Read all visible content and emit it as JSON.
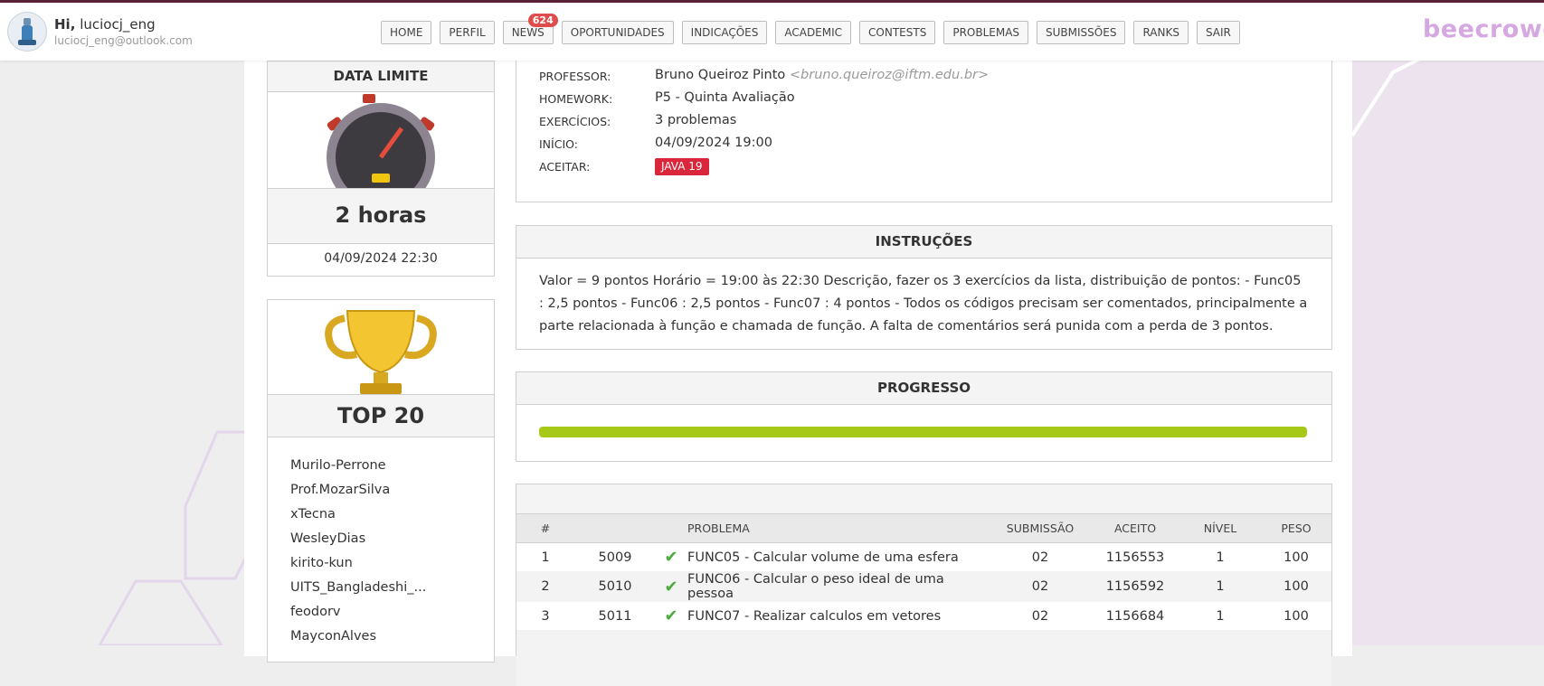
{
  "header": {
    "hi": "Hi,",
    "username": "luciocj_eng",
    "email": "luciocj_eng@outlook.com",
    "brand": "beecrowd",
    "nav": [
      {
        "label": "HOME"
      },
      {
        "label": "PERFIL"
      },
      {
        "label": "NEWS",
        "badge": "624"
      },
      {
        "label": "OPORTUNIDADES"
      },
      {
        "label": "INDICAÇÕES"
      },
      {
        "label": "ACADEMIC"
      },
      {
        "label": "CONTESTS"
      },
      {
        "label": "PROBLEMAS"
      },
      {
        "label": "SUBMISSÕES"
      },
      {
        "label": "RANKS"
      },
      {
        "label": "SAIR"
      }
    ]
  },
  "deadline": {
    "title": "DATA LIMITE",
    "remaining": "2 horas",
    "date": "04/09/2024 22:30"
  },
  "top": {
    "title": "TOP 20",
    "users": [
      "Murilo-Perrone",
      "Prof.MozarSilva",
      "xTecna",
      "WesleyDias",
      "kirito-kun",
      "UITS_Bangladeshi_...",
      "feodorv",
      "MayconAlves"
    ]
  },
  "info": {
    "professor_label": "PROFESSOR:",
    "professor_name": "Bruno Queiroz Pinto",
    "professor_email": "<bruno.queiroz@iftm.edu.br>",
    "homework_label": "HOMEWORK:",
    "homework_value": "P5 - Quinta Avaliação",
    "exercicios_label": "EXERCÍCIOS:",
    "exercicios_value": "3 problemas",
    "inicio_label": "INÍCIO:",
    "inicio_value": "04/09/2024 19:00",
    "aceitar_label": "ACEITAR:",
    "aceitar_value": "JAVA 19"
  },
  "instructions": {
    "title": "INSTRUÇÕES",
    "text": "Valor = 9 pontos Horário = 19:00 às 22:30 Descrição, fazer os 3 exercícios da lista, distribuição de pontos: - Func05 : 2,5 pontos - Func06 : 2,5 pontos - Func07 : 4 pontos - Todos os códigos precisam ser comentados, principalmente a parte relacionada à função e chamada de função. A falta de comentários será punida com a perda de 3 pontos."
  },
  "progress": {
    "title": "PROGRESSO",
    "percent": 100,
    "color": "#a6c817"
  },
  "table": {
    "headers": {
      "num": "#",
      "problema": "PROBLEMA",
      "submissao": "SUBMISSÃO",
      "aceito": "ACEITO",
      "nivel": "NÍVEL",
      "peso": "PESO"
    },
    "rows": [
      {
        "n": "1",
        "id": "5009",
        "name": "FUNC05 - Calcular volume de uma esfera",
        "submissao": "02",
        "aceito": "1156553",
        "nivel": "1",
        "peso": "100"
      },
      {
        "n": "2",
        "id": "5010",
        "name": "FUNC06 - Calcular o peso ideal de uma pessoa",
        "submissao": "02",
        "aceito": "1156592",
        "nivel": "1",
        "peso": "100"
      },
      {
        "n": "3",
        "id": "5011",
        "name": "FUNC07 - Realizar calculos em vetores",
        "submissao": "02",
        "aceito": "1156684",
        "nivel": "1",
        "peso": "100"
      }
    ]
  }
}
